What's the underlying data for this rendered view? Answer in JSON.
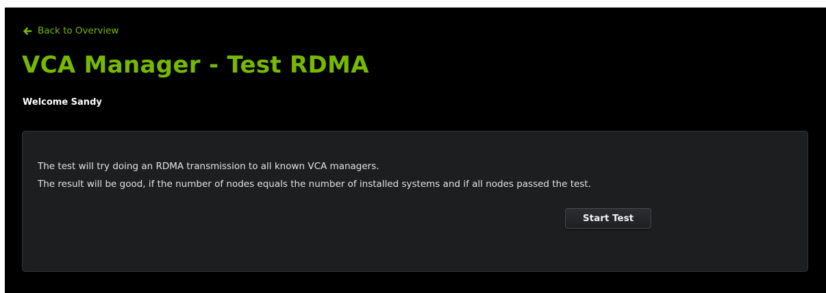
{
  "nav": {
    "back_label": "Back to Overview",
    "back_icon": "arrow-left-icon"
  },
  "header": {
    "title": "VCA Manager - Test RDMA",
    "welcome": "Welcome Sandy"
  },
  "panel": {
    "description_lines": [
      "The test will try doing an RDMA transmission to all known VCA managers.",
      "The result will be good, if the number of nodes equals the number of installed systems and if all nodes passed the test."
    ],
    "start_button_label": "Start Test"
  },
  "colors": {
    "accent": "#76b900",
    "background": "#000000",
    "panel_background": "#1d1e20"
  }
}
